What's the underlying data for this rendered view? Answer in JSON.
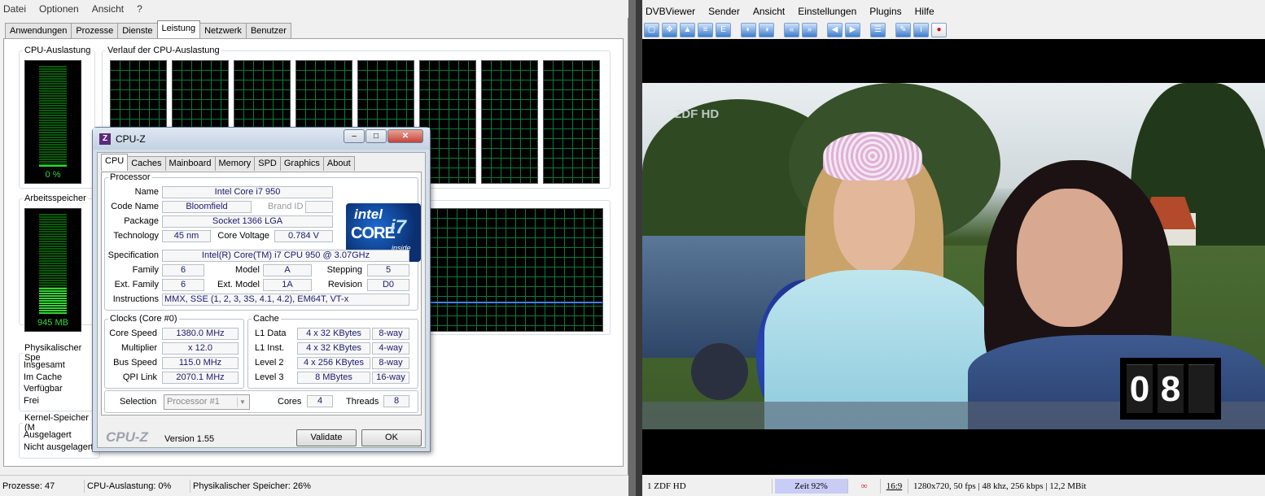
{
  "taskmanager": {
    "menu": [
      "Datei",
      "Optionen",
      "Ansicht",
      "?"
    ],
    "tabs": [
      "Anwendungen",
      "Prozesse",
      "Dienste",
      "Leistung",
      "Netzwerk",
      "Benutzer"
    ],
    "active_tab": "Leistung",
    "cpu_usage_title": "CPU-Auslastung",
    "cpu_usage_value": "0 %",
    "cpu_history_title": "Verlauf der CPU-Auslastung",
    "memory_title": "Arbeitsspeicher",
    "memory_value": "945 MB",
    "memory_fill_fraction": 0.26,
    "physical_title": "Physikalischer Spe",
    "physical_rows": [
      "Insgesamt",
      "Im Cache",
      "Verfügbar",
      "Frei"
    ],
    "kernel_title": "Kernel-Speicher (M",
    "kernel_rows": [
      "Ausgelagert",
      "Nicht ausgelagert"
    ],
    "status": {
      "processes": "Prozesse: 47",
      "cpu": "CPU-Auslastung: 0%",
      "memory": "Physikalischer Speicher: 26%"
    }
  },
  "cpuz": {
    "window_title": "CPU-Z",
    "tabs": [
      "CPU",
      "Caches",
      "Mainboard",
      "Memory",
      "SPD",
      "Graphics",
      "About"
    ],
    "active_tab": "CPU",
    "processor_group": "Processor",
    "name_label": "Name",
    "name": "Intel Core i7 950",
    "codename_label": "Code Name",
    "codename": "Bloomfield",
    "brandid_label": "Brand ID",
    "package_label": "Package",
    "package": "Socket 1366 LGA",
    "technology_label": "Technology",
    "technology": "45 nm",
    "voltage_label": "Core Voltage",
    "voltage": "0.784 V",
    "spec_label": "Specification",
    "spec": "Intel(R) Core(TM) i7 CPU        950  @ 3.07GHz",
    "family_label": "Family",
    "family": "6",
    "model_label": "Model",
    "model": "A",
    "stepping_label": "Stepping",
    "stepping": "5",
    "extfamily_label": "Ext. Family",
    "extfamily": "6",
    "extmodel_label": "Ext. Model",
    "extmodel": "1A",
    "revision_label": "Revision",
    "revision": "D0",
    "instructions_label": "Instructions",
    "instructions": "MMX, SSE (1, 2, 3, 3S, 4.1, 4.2), EM64T, VT-x",
    "logo": {
      "brand": "intel",
      "line": "CORE",
      "model": "i7",
      "tag": "inside"
    },
    "clocks_group": "Clocks (Core #0)",
    "corespeed_label": "Core Speed",
    "corespeed": "1380.0 MHz",
    "multiplier_label": "Multiplier",
    "multiplier": "x 12.0",
    "busspeed_label": "Bus Speed",
    "busspeed": "115.0 MHz",
    "qpi_label": "QPI Link",
    "qpi": "2070.1 MHz",
    "cache_group": "Cache",
    "l1d_label": "L1 Data",
    "l1d": "4 x 32 KBytes",
    "l1d_way": "8-way",
    "l1i_label": "L1 Inst.",
    "l1i": "4 x 32 KBytes",
    "l1i_way": "4-way",
    "l2_label": "Level 2",
    "l2": "4 x 256 KBytes",
    "l2_way": "8-way",
    "l3_label": "Level 3",
    "l3": "8 MBytes",
    "l3_way": "16-way",
    "selection_label": "Selection",
    "selection": "Processor #1",
    "cores_label": "Cores",
    "cores": "4",
    "threads_label": "Threads",
    "threads": "8",
    "footer_logo": "CPU-Z",
    "version": "Version 1.55",
    "validate_button": "Validate",
    "ok_button": "OK"
  },
  "dvbviewer": {
    "menu": [
      "DVBViewer",
      "Sender",
      "Ansicht",
      "Einstellungen",
      "Plugins",
      "Hilfe"
    ],
    "toolbar_icons": [
      "window-icon",
      "fullscreen-icon",
      "video-icon",
      "epg-list-icon",
      "epg-icon",
      "channel-prev-icon",
      "channel-next-icon",
      "rewind-icon",
      "forward-icon",
      "back-icon",
      "next-icon",
      "list-icon",
      "settings-icon",
      "info-icon",
      "record-icon"
    ],
    "channel_logo": "2DF HD",
    "channel_number_overlay": "08",
    "status": {
      "channel": "1 ZDF HD",
      "time": "Zeit 92%",
      "aspect": "16:9",
      "info": "1280x720, 50 fps | 48 khz, 256 kbps | 12,2 MBit"
    },
    "time_progress": 0.92
  }
}
